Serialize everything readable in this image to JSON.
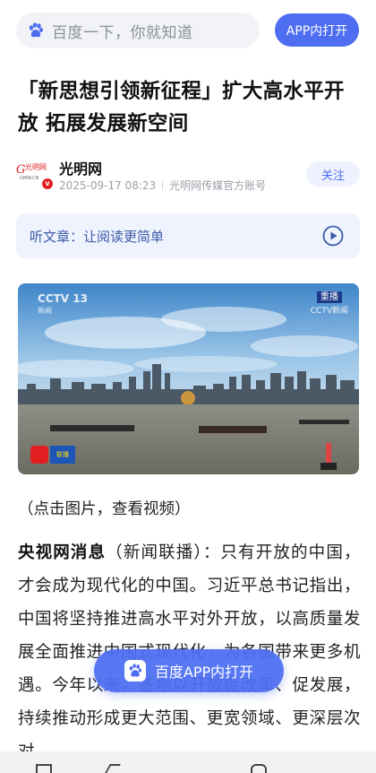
{
  "search": {
    "placeholder": "百度一下，你就知道"
  },
  "header": {
    "app_button_label": "APP内打开"
  },
  "article": {
    "title": "「新思想引领新征程」扩大高水平开放 拓展发展新空间",
    "author": {
      "name": "光明网",
      "date": "2025-09-17 08:23",
      "account_type": "光明网传媒官方账号",
      "follow_label": "关注"
    },
    "listen_label": "听文章：让阅读更简单",
    "video": {
      "channel": "CCTV 13",
      "channel_sub": "新闻",
      "live_tag": "重播",
      "live_channel": "CCTV新闻"
    },
    "caption": "（点击图片，查看视频）",
    "lead_bold": "央视网消息",
    "body": "（新闻联播）：只有开放的中国，才会成为现代化的中国。习近平总书记指出，中国将坚持推进高水平对外开放，以高质量发展全面推进中国式现代化，为各国带来更多机遇。今年以来，各地以开放促改革、促发展，持续推动形成更大范围、更宽领域、更深层次对"
  },
  "floating_button": {
    "label": "百度APP内打开"
  },
  "colors": {
    "accent": "#4e6ef2",
    "listen_bg": "#eef3fd",
    "follow_bg": "#eef2ff"
  }
}
